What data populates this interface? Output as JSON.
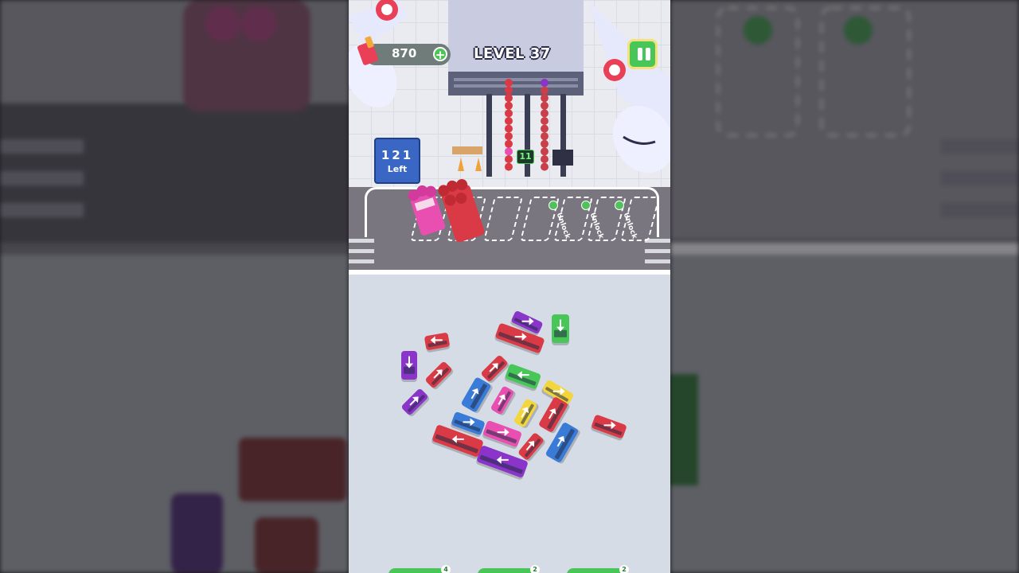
{
  "hud": {
    "coins": "870",
    "level": "LEVEL 37",
    "plus_icon": "plus-icon",
    "pause_icon": "pause-icon"
  },
  "counter": {
    "number": "121",
    "label": "Left"
  },
  "queue": {
    "waiting_count": "11"
  },
  "slots": {
    "unlock_label": "Unlock",
    "unlock_count": 3
  },
  "bottom_buttons": [
    "4",
    "2",
    "2"
  ],
  "colors": {
    "green": "#48c758",
    "red": "#d93a45",
    "blue": "#3a7bd8",
    "purple": "#8a34c9",
    "pink": "#e94fb0",
    "yellow": "#f3d63c"
  }
}
